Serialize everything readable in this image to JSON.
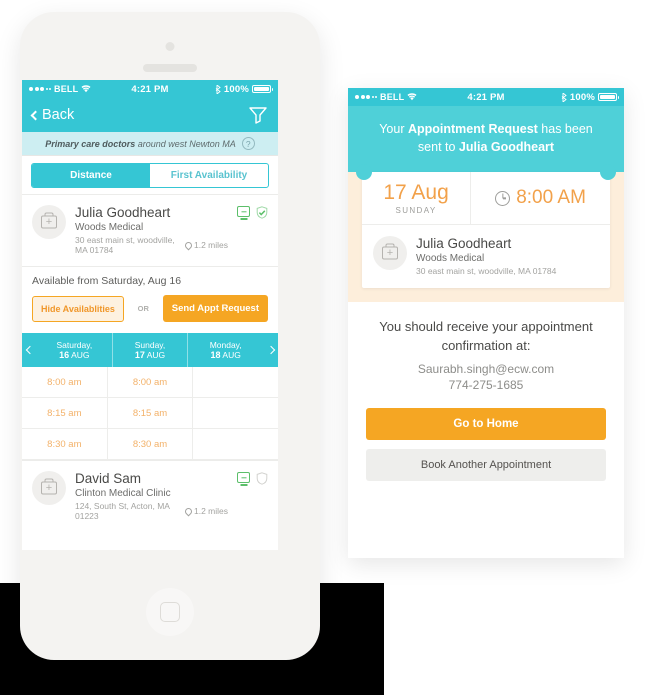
{
  "status_bar": {
    "carrier": "BELL",
    "time": "4:21 PM",
    "battery": "100%",
    "signal_dots_filled": 3,
    "signal_dots_empty": 2,
    "wifi_icon": "wifi-icon",
    "bluetooth_icon": "bluetooth-icon"
  },
  "left_screen": {
    "nav": {
      "back_label": "Back",
      "back_icon": "chevron-left-icon",
      "filter_icon": "funnel-filter-icon"
    },
    "subtitle": {
      "emphasis": "Primary care doctors",
      "rest": " around west Newton MA",
      "help_icon": "question-mark-icon"
    },
    "segments": [
      {
        "label": "Distance",
        "active": true
      },
      {
        "label": "First Availability",
        "active": false
      }
    ],
    "doctor_primary": {
      "name": "Julia Goodheart",
      "clinic": "Woods Medical",
      "address": "30 east main st, woodville, MA 01784",
      "distance": "1.2 miles",
      "avatar_icon": "medical-bag-icon",
      "distance_icon": "map-pin-icon",
      "telehealth_icon": "monitor-telehealth-icon",
      "verified_icon": "shield-check-icon",
      "verified_color": "#5cbf6a",
      "telehealth_color": "#5cbf6a"
    },
    "availability": {
      "text": "Available from Saturday, Aug 16",
      "hide_button": "Hide Availablities",
      "or_label": "OR",
      "send_button": "Send Appt Request"
    },
    "calendar": {
      "prev_icon": "chevron-left-icon",
      "next_icon": "chevron-right-icon",
      "days": [
        {
          "weekday": "Saturday,",
          "day": "16",
          "month": "AUG"
        },
        {
          "weekday": "Sunday,",
          "day": "17",
          "month": "AUG"
        },
        {
          "weekday": "Monday,",
          "day": "18",
          "month": "AUG"
        }
      ],
      "slots": [
        [
          "8:00 am",
          "8:00 am",
          ""
        ],
        [
          "8:15 am",
          "8:15 am",
          ""
        ],
        [
          "8:30 am",
          "8:30 am",
          ""
        ]
      ]
    },
    "doctor_secondary": {
      "name": "David Sam",
      "clinic": "Clinton Medical Clinic",
      "address": "124, South St, Acton, MA 01223",
      "distance": "1.2 miles",
      "avatar_icon": "medical-bag-icon",
      "distance_icon": "map-pin-icon",
      "telehealth_icon": "monitor-telehealth-icon",
      "verified_icon": "shield-icon",
      "verified_color": "#cdcdca",
      "telehealth_color": "#5cbf6a"
    }
  },
  "right_screen": {
    "banner": {
      "line1_a": "Your ",
      "line1_b": "Appointment Request",
      "line1_c": " has been",
      "line2_a": "sent to ",
      "line2_b": "Julia Goodheart"
    },
    "ticket": {
      "date": "17 Aug",
      "weekday": "SUNDAY",
      "clock_icon": "clock-icon",
      "time": "8:00 AM",
      "doctor_name": "Julia Goodheart",
      "clinic": "Woods Medical",
      "address": "30 east main st, woodville, MA 01784",
      "avatar_icon": "medical-bag-icon"
    },
    "confirmation": {
      "message_line1": "You should receive your appointment",
      "message_line2": "confirmation at:",
      "email": "Saurabh.singh@ecw.com",
      "phone": "774-275-1685"
    },
    "buttons": {
      "primary": "Go to Home",
      "secondary": "Book Another Appointment"
    }
  },
  "theme": {
    "teal": "#35c6d4",
    "teal_light": "#4fd0d8",
    "pale_cyan": "#cdeef2",
    "orange": "#f5a623",
    "orange_soft": "#f3b26a",
    "cream": "#fdeedb",
    "green": "#5cbf6a"
  }
}
